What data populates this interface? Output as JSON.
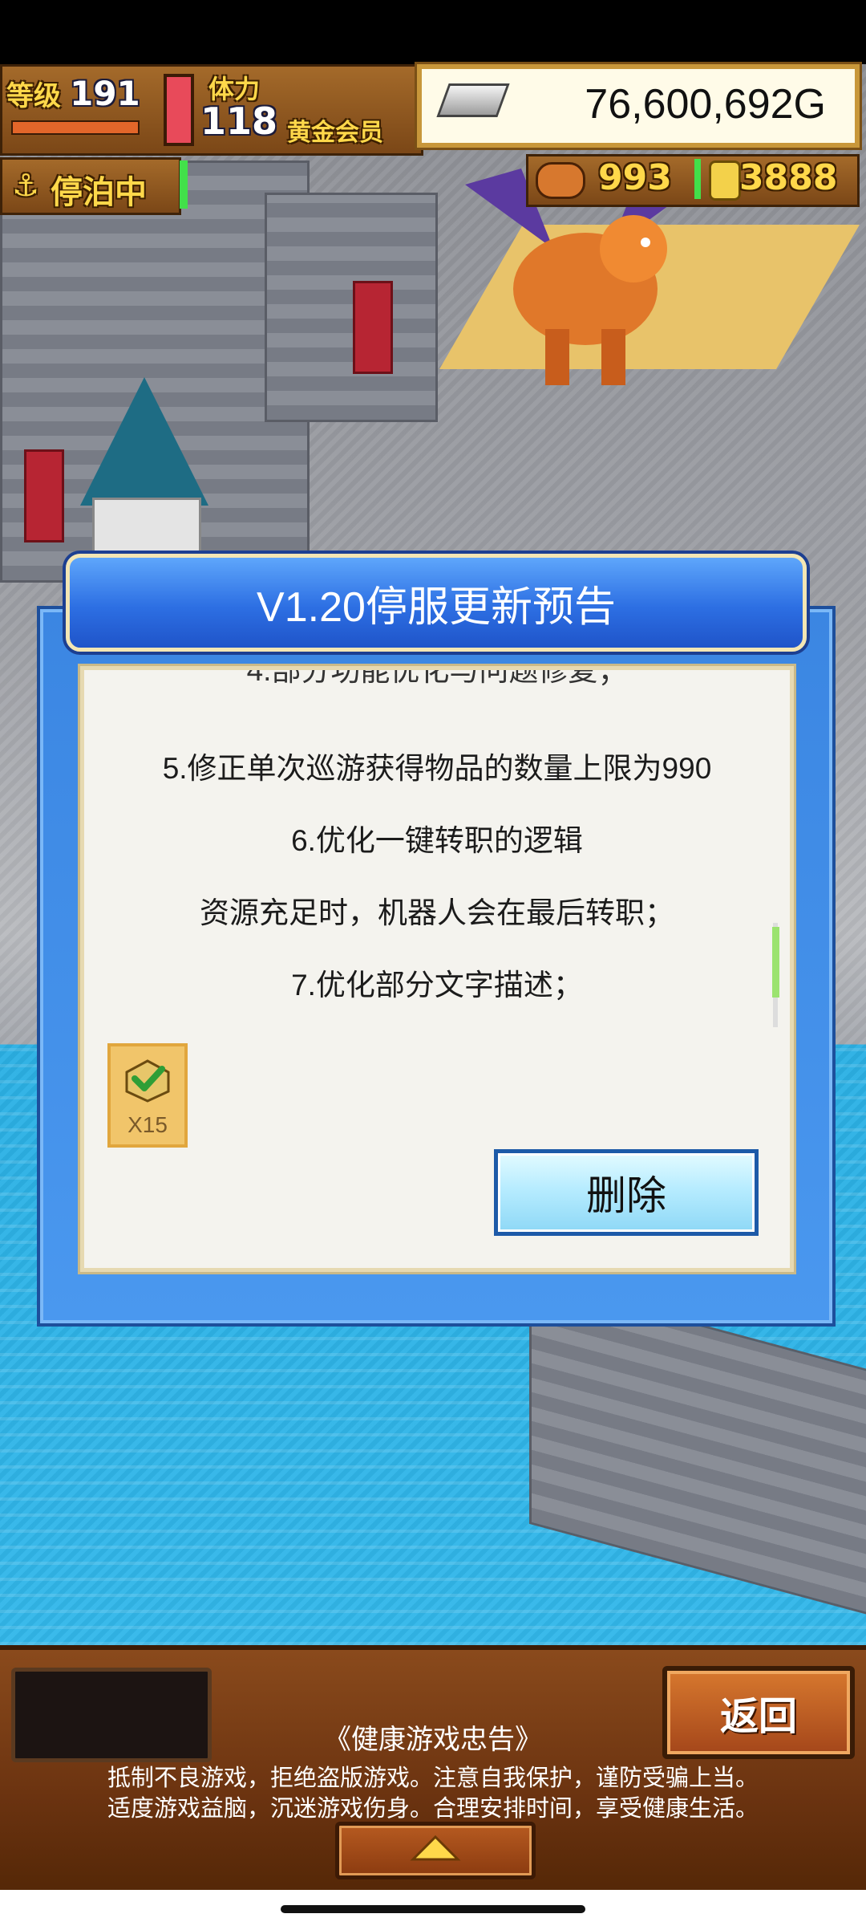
{
  "hud": {
    "level_label": "等级",
    "level_value": "191",
    "stamina_label": "体力",
    "stamina_value": "118",
    "member_label": "黄金会员",
    "gold_amount": "76,600,692G",
    "docked_label": "停泊中",
    "food_count": "993",
    "coin_count": "3888"
  },
  "dialog": {
    "title": "V1.20停服更新预告",
    "lines": [
      "5.修正单次巡游获得物品的数量上限为990",
      "6.优化一键转职的逻辑",
      "资源充足时，机器人会在最后转职；",
      "7.优化部分文字描述；"
    ],
    "item_count": "X15",
    "delete_label": "删除"
  },
  "footer": {
    "back_label": "返回",
    "advisory_title": "《健康游戏忠告》",
    "advisory_line1": "抵制不良游戏，拒绝盗版游戏。注意自我保护，谨防受骗上当。",
    "advisory_line2": "适度游戏益脑，沉迷游戏伤身。合理安排时间，享受健康生活。"
  },
  "colors": {
    "dialog_blue": "#3b86e2",
    "title_blue": "#2d6fe3",
    "hud_gold": "#ffd84a",
    "wood": "#7b4717"
  }
}
